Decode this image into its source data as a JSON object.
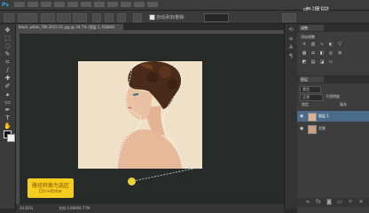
{
  "app": {
    "logo": "Ps"
  },
  "watermark": "虎课网",
  "document": {
    "tab_title": "black_white_FIN-2015-01.jpg @ 34.7% (图层 1, RGB/8)",
    "zoom": "34.65%",
    "doc_size": "文档:4.89M/9.77M"
  },
  "options": {
    "auto_add_delete_label": "自动添加/删除"
  },
  "tooltip": {
    "title": "路径转换为选区",
    "shortcut": "Ctrl+Enter"
  },
  "adjustments": {
    "tab_label": "调整",
    "title": "添加调整"
  },
  "layers": {
    "tab_label": "图层",
    "kind_label": "类型",
    "blend_mode": "正常",
    "opacity_label": "不透明度",
    "fill_label": "填充",
    "lock_label": "锁定",
    "items": [
      {
        "name": "图层 1",
        "selected": true
      },
      {
        "name": "背景",
        "selected": false
      }
    ]
  },
  "colors": {
    "accent": "#f6cd1f",
    "canvas_bg": "#262b29",
    "photo_bg": "#eee1c8"
  }
}
